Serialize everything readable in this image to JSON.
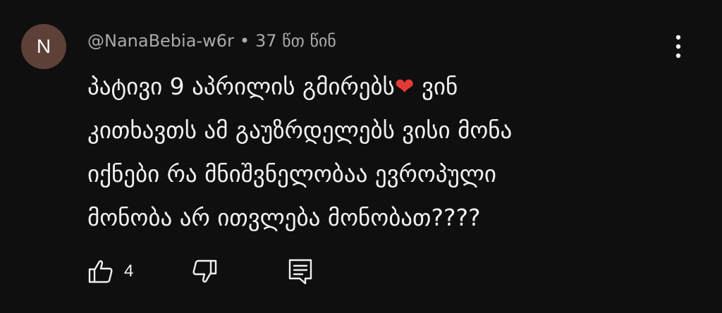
{
  "comment": {
    "avatar_initial": "N",
    "author": "@NanaBebia-w6r",
    "separator": "•",
    "time_ago": "37 წთ წინ",
    "text_before_heart": "პატივი 9 აპრილის გმირებს",
    "heart": "❤",
    "text_after_heart": " ვინ\nკითხავთს ამ გაუზრდელებს ვისი მონა\nიქნები რა მნიშვნელობაა ევროპული\nმონობა არ ითვლება მონობათ????",
    "like_count": "4"
  },
  "icons": {
    "menu": "more-vert-icon",
    "like": "thumb-up-icon",
    "dislike": "thumb-down-icon",
    "reply": "reply-comment-icon"
  },
  "colors": {
    "background": "#0f0f0f",
    "avatar_bg": "#5d4037",
    "heart": "#e53935",
    "meta_text": "#aaaaaa"
  }
}
